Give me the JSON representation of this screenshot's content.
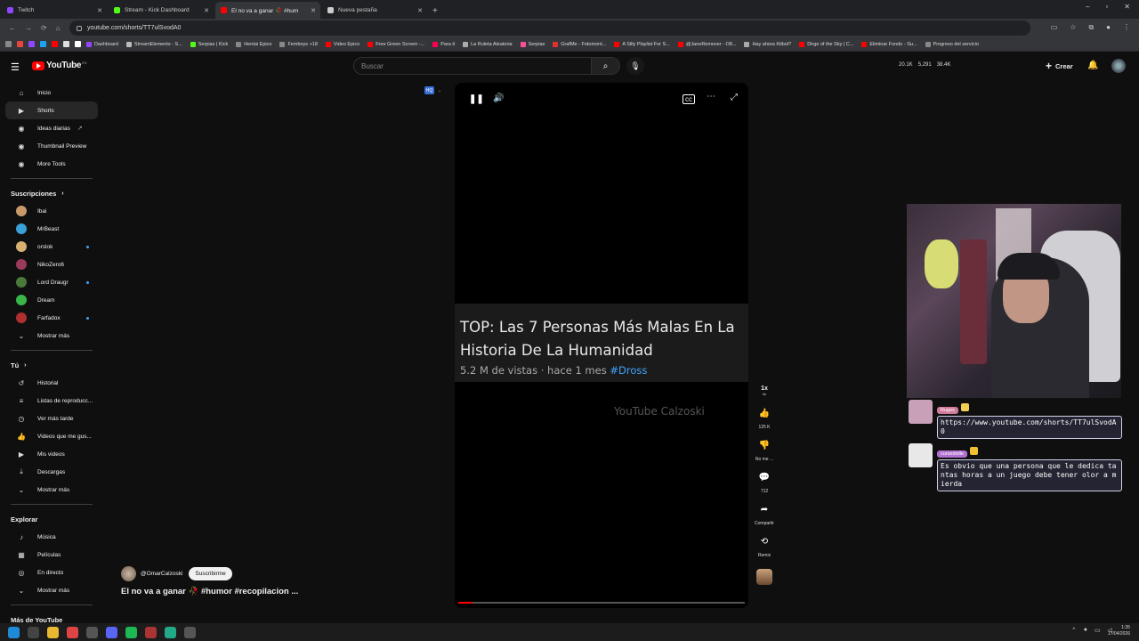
{
  "browser": {
    "tabs": [
      {
        "label": "Twitch",
        "color": "#9146ff",
        "active": false
      },
      {
        "label": "Stream - Kick Dashboard",
        "color": "#53fc18",
        "active": false
      },
      {
        "label": "El no va a ganar 🥀 #hum",
        "color": "#ff0000",
        "active": true
      },
      {
        "label": "Nueva pestaña",
        "color": "#cccccc",
        "active": false
      }
    ],
    "url": "youtube.com/shorts/TT7ulSvodA0",
    "bookmarks": [
      {
        "label": "Dashboard",
        "color": "#9146ff"
      },
      {
        "label": "StreamElements - S...",
        "color": "#bbbbbb"
      },
      {
        "label": "Serpias | Kick",
        "color": "#53fc18"
      },
      {
        "label": "Hentai Epico",
        "color": "#888888"
      },
      {
        "label": "Femboys +18",
        "color": "#888888"
      },
      {
        "label": "Video Epico",
        "color": "#ff0000"
      },
      {
        "label": "Free Green Screen -...",
        "color": "#ff0000"
      },
      {
        "label": "Para ti",
        "color": "#ff0050"
      },
      {
        "label": "La Ruleta Aleatoria",
        "color": "#aaaaaa"
      },
      {
        "label": "Serpias",
        "color": "#ff4f9a"
      },
      {
        "label": "GrafMe - Fotomont...",
        "color": "#e03030"
      },
      {
        "label": "A Silly Playlist For S...",
        "color": "#ff0000"
      },
      {
        "label": "@JaneRemover - O8...",
        "color": "#ff0000"
      },
      {
        "label": "Hay ahora Kitbol?",
        "color": "#aaaaaa"
      },
      {
        "label": "Dirge of the Sky | C...",
        "color": "#ff0000"
      },
      {
        "label": "Eliminar Fondo - Su...",
        "color": "#ff0000"
      },
      {
        "label": "Progreso del servicio",
        "color": "#888888"
      }
    ]
  },
  "youtube": {
    "logo": "YouTube",
    "country": "ES",
    "search_placeholder": "Buscar",
    "stats": [
      "20.1K",
      "5,291",
      "38.4K"
    ],
    "create_label": "Crear"
  },
  "sidebar": {
    "main": [
      {
        "label": "Inicio",
        "icon": "home-icon",
        "glyph": "⌂"
      },
      {
        "label": "Shorts",
        "icon": "shorts-icon",
        "glyph": "▶"
      },
      {
        "label": "Ideas diarias",
        "icon": "bulb-icon",
        "glyph": "◉"
      },
      {
        "label": "Thumbnail Preview",
        "icon": "thumb-icon",
        "glyph": "◉"
      },
      {
        "label": "More Tools",
        "icon": "tools-icon",
        "glyph": "◉"
      }
    ],
    "subs_title": "Suscripciones",
    "subs": [
      {
        "label": "Ibai",
        "color": "#c89a6a",
        "live": false
      },
      {
        "label": "MrBeast",
        "color": "#3aa0d8",
        "live": false
      },
      {
        "label": "orslok",
        "color": "#d8b070",
        "live": true
      },
      {
        "label": "NikoZero6",
        "color": "#9a3b5a",
        "live": false
      },
      {
        "label": "Lord Draugr",
        "color": "#4a7a3a",
        "live": true
      },
      {
        "label": "Dream",
        "color": "#3ab54a",
        "live": false
      },
      {
        "label": "Farfadox",
        "color": "#b03030",
        "live": true
      }
    ],
    "subs_more": "Mostrar más",
    "you_title": "Tú",
    "you": [
      {
        "label": "Historial",
        "glyph": "↺",
        "icon": "history-icon"
      },
      {
        "label": "Listas de reproducc...",
        "glyph": "≡",
        "icon": "playlists-icon"
      },
      {
        "label": "Ver más tarde",
        "glyph": "◷",
        "icon": "watch-later-icon"
      },
      {
        "label": "Videos que me gus...",
        "glyph": "👍",
        "icon": "liked-icon"
      },
      {
        "label": "Mis videos",
        "glyph": "▶",
        "icon": "my-videos-icon"
      },
      {
        "label": "Descargas",
        "glyph": "⤓",
        "icon": "downloads-icon"
      }
    ],
    "you_more": "Mostrar más",
    "explore_title": "Explorar",
    "explore": [
      {
        "label": "Música",
        "glyph": "♪",
        "icon": "music-icon"
      },
      {
        "label": "Películas",
        "glyph": "▦",
        "icon": "movies-icon"
      },
      {
        "label": "En directo",
        "glyph": "◎",
        "icon": "live-icon"
      }
    ],
    "explore_more": "Mostrar más",
    "more_title": "Más de YouTube"
  },
  "video": {
    "title": "TOP: Las 7 Personas Más Malas En La Historia De La Humanidad",
    "meta": "5.2 M de vistas · hace 1 mes ",
    "hashtag": "#Dross",
    "watermark": "YouTube Calzoski",
    "progress": 0.05,
    "channel": "@OmarCalzoski",
    "subscribe": "Suscribirme",
    "caption": "El no va a ganar 🥀 #humor #recopilacion ..."
  },
  "actions": {
    "speed": "1x",
    "speed_sub": "3x",
    "likes": "125 K",
    "dislike": "No me ...",
    "comments": "712",
    "share": "Compartir",
    "remix": "Remix"
  },
  "chat": [
    {
      "user": "Rugex",
      "user_color": "#d07a9a",
      "avatar": "#c8a0b8",
      "badge": "#f0d050",
      "text": "https://www.youtube.com/shorts/TT7ulSvodA0"
    },
    {
      "user": "cursedville",
      "user_color": "#b070d0",
      "avatar": "#e8e8e8",
      "badge": "#f0c030",
      "text": "Es obvio que una persona que le dedica tantas horas a un juego debe tener olor a mierda"
    }
  ],
  "clock": {
    "time": "1:35",
    "date": "17/04/2026"
  }
}
